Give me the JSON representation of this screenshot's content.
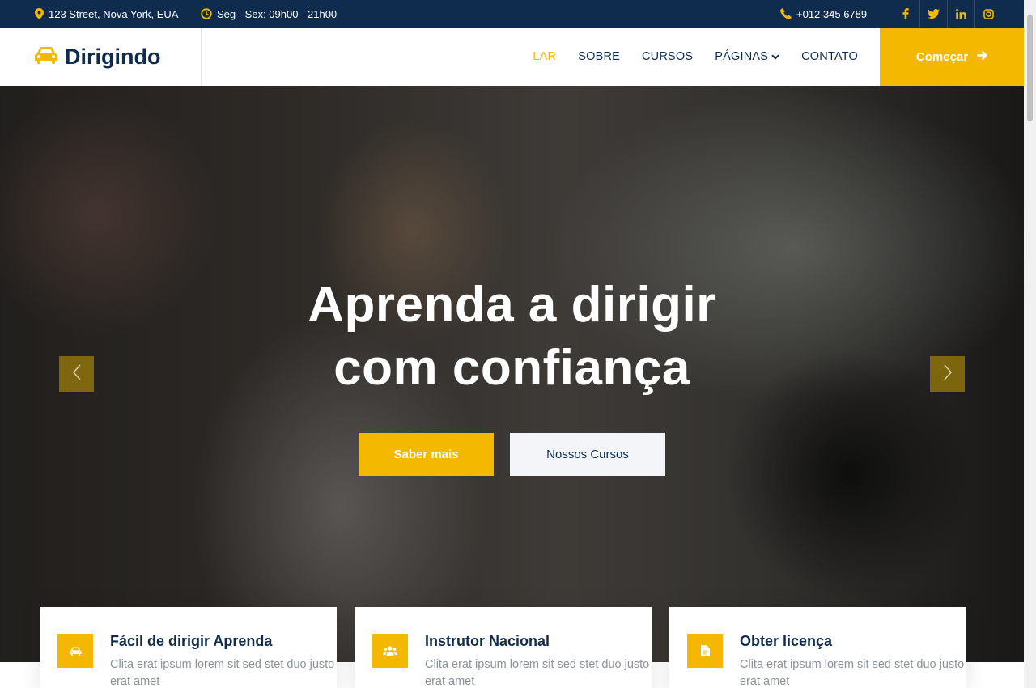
{
  "topbar": {
    "address": "123 Street, Nova York, EUA",
    "hours": "Seg - Sex: 09h00 - 21h00",
    "phone": "+012 345 6789",
    "social": [
      "facebook-icon",
      "twitter-icon",
      "linkedin-icon",
      "instagram-icon"
    ]
  },
  "brand": {
    "name": "Dirigindo",
    "icon": "car-icon"
  },
  "nav": {
    "items": [
      {
        "label": "LAR",
        "active": true
      },
      {
        "label": "SOBRE"
      },
      {
        "label": "CURSOS"
      },
      {
        "label": "PÁGINAS",
        "dropdown": true
      },
      {
        "label": "CONTATO"
      }
    ],
    "cta": "Começar"
  },
  "hero": {
    "title_line1": "Aprenda a dirigir",
    "title_line2": "com confiança",
    "primary_button": "Saber mais",
    "secondary_button": "Nossos Cursos"
  },
  "features": [
    {
      "title": "Fácil de dirigir Aprenda",
      "text": "Clita erat ipsum lorem sit sed stet duo justo erat amet",
      "icon": "car-icon"
    },
    {
      "title": "Instrutor Nacional",
      "text": "Clita erat ipsum lorem sit sed stet duo justo erat amet",
      "icon": "users-icon"
    },
    {
      "title": "Obter licença",
      "text": "Clita erat ipsum lorem sit sed stet duo justo erat amet",
      "icon": "file-icon"
    }
  ],
  "colors": {
    "primary": "#f4b800",
    "dark": "#0f2c4f",
    "muted": "#8a929b"
  }
}
